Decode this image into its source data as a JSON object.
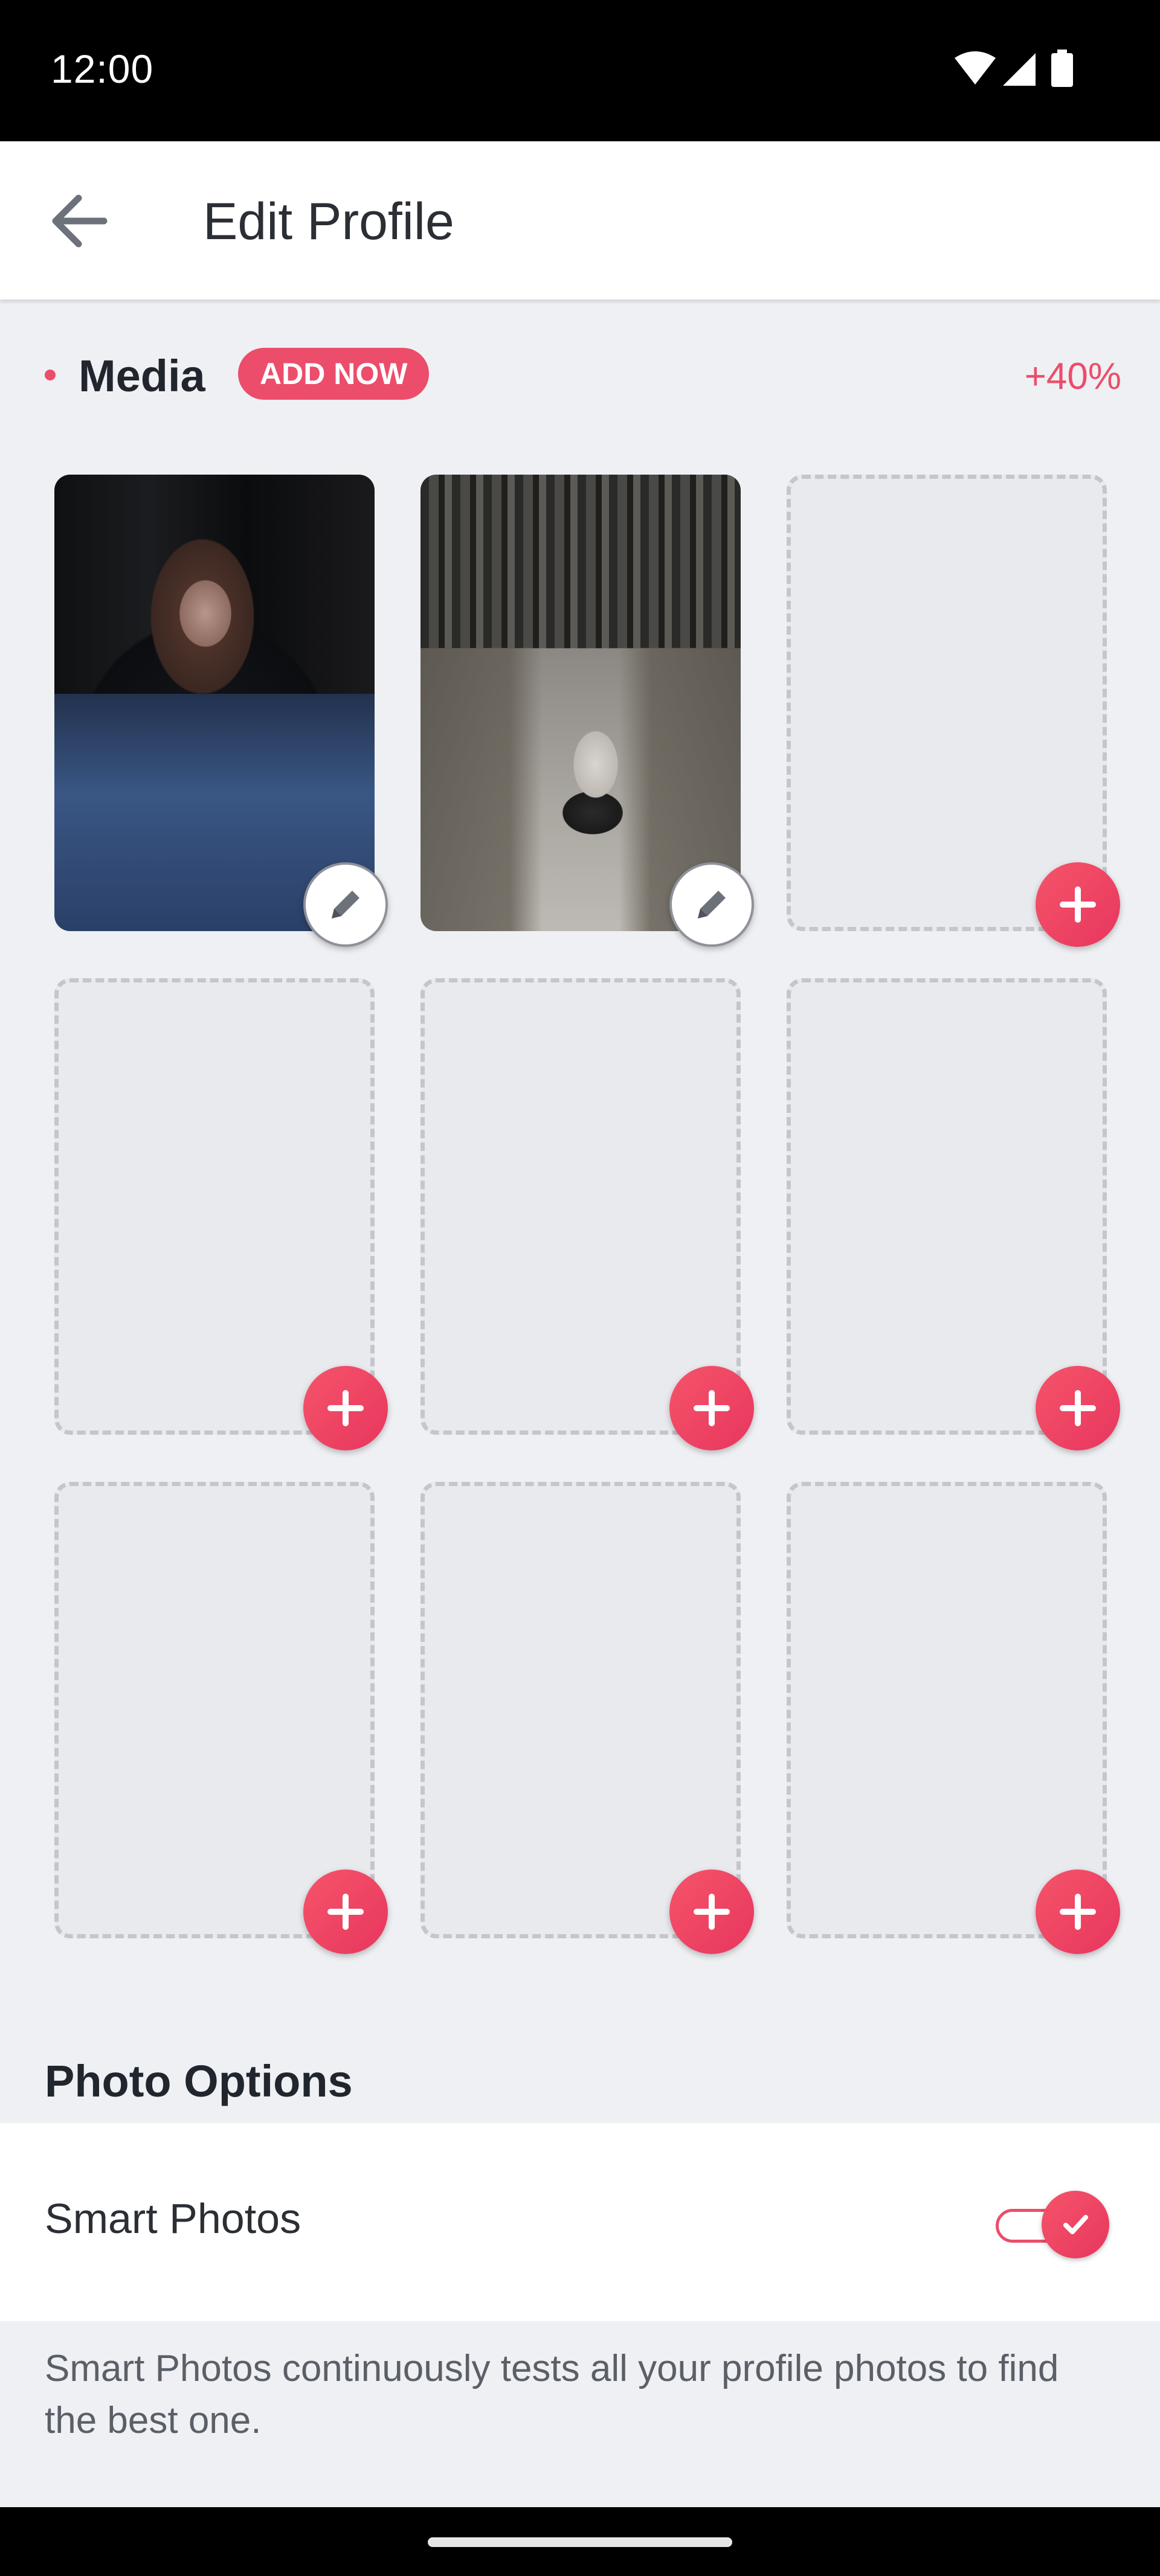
{
  "status_bar": {
    "time": "12:00",
    "icons": [
      "wifi-icon",
      "signal-icon",
      "battery-icon"
    ]
  },
  "app_bar": {
    "back_icon": "arrow-left-icon",
    "title": "Edit Profile"
  },
  "media": {
    "label": "Media",
    "add_now": "ADD NOW",
    "percent": "+40%",
    "accent_color": "#ec4d6b",
    "slots": [
      {
        "state": "photo",
        "action": "edit"
      },
      {
        "state": "photo",
        "action": "edit"
      },
      {
        "state": "empty",
        "action": "add"
      },
      {
        "state": "empty",
        "action": "add"
      },
      {
        "state": "empty",
        "action": "add"
      },
      {
        "state": "empty",
        "action": "add"
      },
      {
        "state": "empty",
        "action": "add"
      },
      {
        "state": "empty",
        "action": "add"
      },
      {
        "state": "empty",
        "action": "add"
      }
    ]
  },
  "photo_options": {
    "title": "Photo Options",
    "smart_photos": {
      "label": "Smart Photos",
      "enabled": true,
      "description": "Smart Photos continuously tests all your profile photos to find the best one."
    }
  }
}
